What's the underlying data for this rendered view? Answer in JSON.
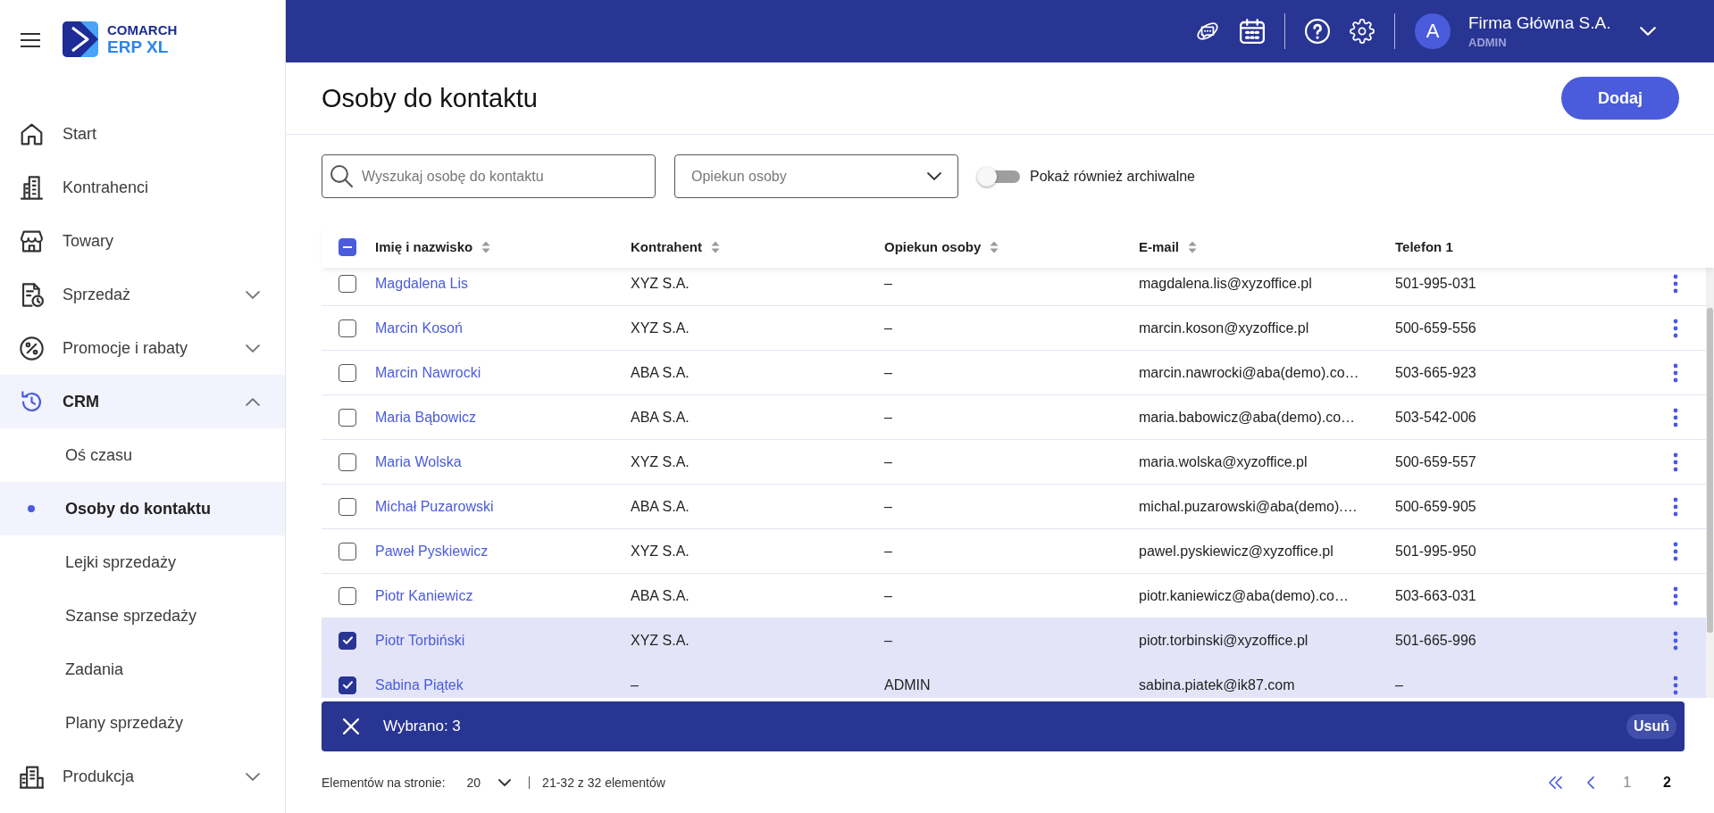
{
  "sidebar": {
    "logo": {
      "brand": "COMARCH",
      "product": "ERP XL"
    },
    "items": [
      {
        "label": "Start",
        "kind": "link",
        "selected": false
      },
      {
        "label": "Kontrahenci",
        "kind": "link",
        "selected": false
      },
      {
        "label": "Towary",
        "kind": "link",
        "selected": false
      },
      {
        "label": "Sprzedaż",
        "kind": "group",
        "expanded": false,
        "selected": false
      },
      {
        "label": "Promocje i rabaty",
        "kind": "group",
        "expanded": false,
        "selected": false
      },
      {
        "label": "CRM",
        "kind": "group",
        "expanded": true,
        "selected": true,
        "children": [
          {
            "label": "Oś czasu",
            "selected": false
          },
          {
            "label": "Osoby do kontaktu",
            "selected": true
          },
          {
            "label": "Lejki sprzedaży",
            "selected": false
          },
          {
            "label": "Szanse sprzedaży",
            "selected": false
          },
          {
            "label": "Zadania",
            "selected": false
          },
          {
            "label": "Plany sprzedaży",
            "selected": false
          }
        ]
      },
      {
        "label": "Produkcja",
        "kind": "group",
        "expanded": false,
        "selected": false
      }
    ]
  },
  "topbar": {
    "avatar_initial": "A",
    "company": "Firma Główna S.A.",
    "role": "ADMIN"
  },
  "page": {
    "title": "Osoby do kontaktu",
    "add_button": "Dodaj"
  },
  "filters": {
    "search": {
      "placeholder": "Wyszukaj osobę do kontaktu"
    },
    "caretaker": {
      "placeholder": "Opiekun osoby"
    },
    "archived_toggle": {
      "label": "Pokaż również archiwalne",
      "on": false
    }
  },
  "table": {
    "select_all": {
      "indeterminate": true
    },
    "columns": [
      {
        "label": "Imię i nazwisko",
        "sortable": true
      },
      {
        "label": "Kontrahent",
        "sortable": true
      },
      {
        "label": "Opiekun osoby",
        "sortable": true
      },
      {
        "label": "E-mail",
        "sortable": true
      },
      {
        "label": "Telefon 1",
        "sortable": false
      }
    ],
    "rows": [
      {
        "selected": false,
        "cells": [
          "Magdalena Lis",
          "XYZ S.A.",
          "–",
          "magdalena.lis@xyzoffice.pl",
          "501-995-031"
        ]
      },
      {
        "selected": false,
        "cells": [
          "Marcin Kosoń",
          "XYZ S.A.",
          "–",
          "marcin.koson@xyzoffice.pl",
          "500-659-556"
        ]
      },
      {
        "selected": false,
        "cells": [
          "Marcin Nawrocki",
          "ABA S.A.",
          "–",
          "marcin.nawrocki@aba(demo).co…",
          "503-665-923"
        ]
      },
      {
        "selected": false,
        "cells": [
          "Maria Bąbowicz",
          "ABA S.A.",
          "–",
          "maria.babowicz@aba(demo).co…",
          "503-542-006"
        ]
      },
      {
        "selected": false,
        "cells": [
          "Maria Wolska",
          "XYZ S.A.",
          "–",
          "maria.wolska@xyzoffice.pl",
          "500-659-557"
        ]
      },
      {
        "selected": false,
        "cells": [
          "Michał Puzarowski",
          "ABA S.A.",
          "–",
          "michal.puzarowski@aba(demo).…",
          "500-659-905"
        ]
      },
      {
        "selected": false,
        "cells": [
          "Paweł Pyskiewicz",
          "XYZ S.A.",
          "–",
          "pawel.pyskiewicz@xyzoffice.pl",
          "501-995-950"
        ]
      },
      {
        "selected": false,
        "cells": [
          "Piotr Kaniewicz",
          "ABA S.A.",
          "–",
          "piotr.kaniewicz@aba(demo).co…",
          "503-663-031"
        ]
      },
      {
        "selected": true,
        "cells": [
          "Piotr Torbiński",
          "XYZ S.A.",
          "–",
          "piotr.torbinski@xyzoffice.pl",
          "501-665-996"
        ]
      },
      {
        "selected": true,
        "cells": [
          "Sabina Piątek",
          "–",
          "ADMIN",
          "sabina.piatek@ik87.com",
          "–"
        ]
      }
    ]
  },
  "selection_bar": {
    "count": "Wybrano: 3",
    "delete_button": "Usuń"
  },
  "pagination": {
    "page_size_label": "Elementów na stronie:",
    "page_size": "20",
    "range": "21-32 z 32 elementów",
    "pages": [
      {
        "label": "1",
        "selected": false
      },
      {
        "label": "2",
        "selected": true
      }
    ]
  }
}
